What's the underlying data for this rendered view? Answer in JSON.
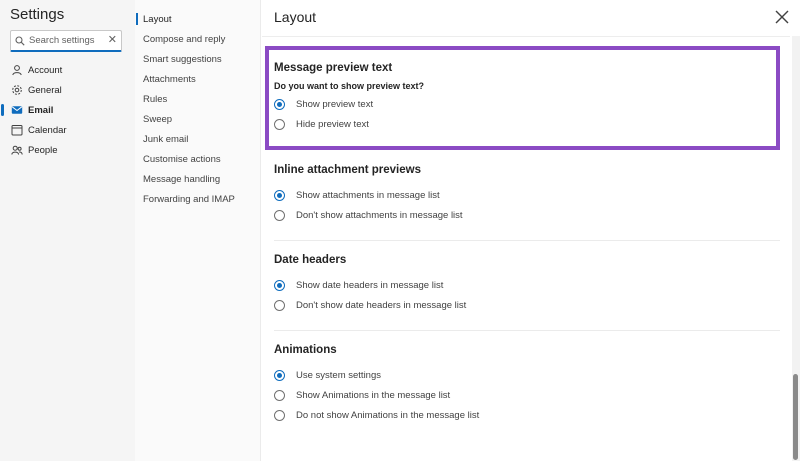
{
  "settings": {
    "title": "Settings",
    "search_placeholder": "Search settings",
    "clear_glyph": "✕",
    "categories": [
      {
        "label": "Account",
        "icon": "person-icon"
      },
      {
        "label": "General",
        "icon": "gear-icon"
      },
      {
        "label": "Email",
        "icon": "mail-icon",
        "active": true
      },
      {
        "label": "Calendar",
        "icon": "calendar-icon"
      },
      {
        "label": "People",
        "icon": "people-icon"
      }
    ]
  },
  "subnav": {
    "items": [
      {
        "label": "Layout",
        "active": true
      },
      {
        "label": "Compose and reply"
      },
      {
        "label": "Smart suggestions"
      },
      {
        "label": "Attachments"
      },
      {
        "label": "Rules"
      },
      {
        "label": "Sweep"
      },
      {
        "label": "Junk email"
      },
      {
        "label": "Customise actions"
      },
      {
        "label": "Message handling"
      },
      {
        "label": "Forwarding and IMAP"
      }
    ]
  },
  "content": {
    "title": "Layout",
    "sections": [
      {
        "title": "Message preview text",
        "question": "Do you want to show preview text?",
        "options": [
          {
            "label": "Show preview text",
            "checked": true
          },
          {
            "label": "Hide preview text",
            "checked": false
          }
        ]
      },
      {
        "title": "Inline attachment previews",
        "options": [
          {
            "label": "Show attachments in message list",
            "checked": true
          },
          {
            "label": "Don't show attachments in message list",
            "checked": false
          }
        ]
      },
      {
        "title": "Date headers",
        "options": [
          {
            "label": "Show date headers in message list",
            "checked": true
          },
          {
            "label": "Don't show date headers in message list",
            "checked": false
          }
        ]
      },
      {
        "title": "Animations",
        "options": [
          {
            "label": "Use system settings",
            "checked": true
          },
          {
            "label": "Show Animations in the message list",
            "checked": false
          },
          {
            "label": "Do not show Animations in the message list",
            "checked": false
          }
        ]
      }
    ]
  },
  "colors": {
    "accent": "#0f6cbd",
    "highlight_border": "#8b4bc4"
  }
}
